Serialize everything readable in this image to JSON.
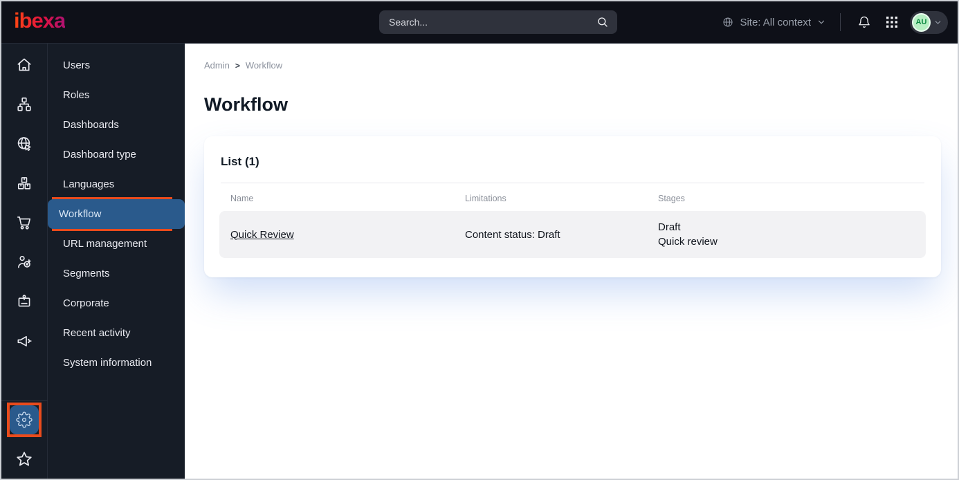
{
  "topbar": {
    "logo_text": "ibexa",
    "search": {
      "placeholder": "Search..."
    },
    "site_selector": {
      "label": "Site: All context"
    },
    "avatar": {
      "initials": "AU"
    }
  },
  "icon_rail": {
    "items": [
      "home",
      "content-tree",
      "site",
      "products",
      "commerce",
      "personalization",
      "corporate-badge",
      "marketing-megaphone"
    ],
    "bottom": [
      "settings-gear",
      "favorites-star"
    ]
  },
  "menu": {
    "items": [
      {
        "label": "Users",
        "selected": false
      },
      {
        "label": "Roles",
        "selected": false
      },
      {
        "label": "Dashboards",
        "selected": false
      },
      {
        "label": "Dashboard type",
        "selected": false
      },
      {
        "label": "Languages",
        "selected": false
      },
      {
        "label": "Workflow",
        "selected": true
      },
      {
        "label": "URL management",
        "selected": false
      },
      {
        "label": "Segments",
        "selected": false
      },
      {
        "label": "Corporate",
        "selected": false
      },
      {
        "label": "Recent activity",
        "selected": false
      },
      {
        "label": "System information",
        "selected": false
      }
    ]
  },
  "breadcrumb": {
    "items": [
      {
        "label": "Admin"
      },
      {
        "label": "Workflow"
      }
    ],
    "separator": ">"
  },
  "page": {
    "title": "Workflow"
  },
  "list_card": {
    "title": "List (1)",
    "columns": [
      "Name",
      "Limitations",
      "Stages"
    ],
    "rows": [
      {
        "name": "Quick Review",
        "limitations": "Content status: Draft",
        "stages": [
          "Draft",
          "Quick review"
        ]
      }
    ]
  },
  "colors": {
    "annotation_orange": "#ea4b1c",
    "selected_blue": "#2a5a8c",
    "logo_gradient": [
      "#ff4713",
      "#e3123f",
      "#ae1271"
    ],
    "avatar_bg": "#b7efc3",
    "avatar_text": "#0d8a42",
    "topbar_bg": "#0e1018",
    "sidebar_bg": "#161c26"
  }
}
